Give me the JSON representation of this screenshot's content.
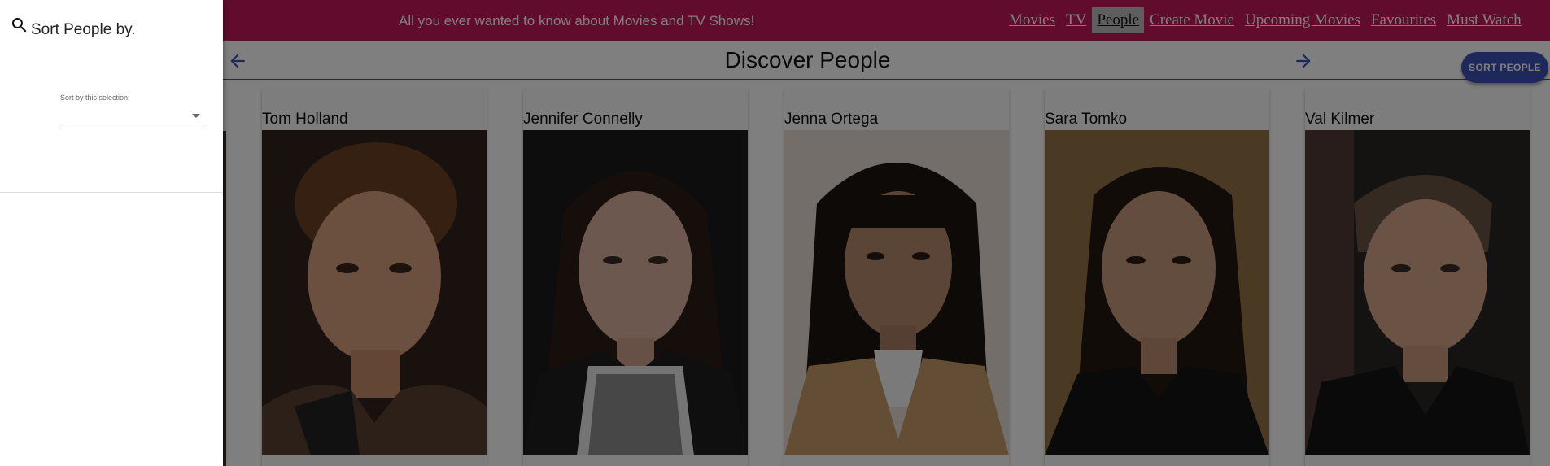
{
  "header": {
    "tagline": "All you ever wanted to know about Movies and TV Shows!",
    "nav": [
      {
        "label": "Movies",
        "active": false
      },
      {
        "label": "TV",
        "active": false
      },
      {
        "label": "People",
        "active": true
      },
      {
        "label": "Create Movie",
        "active": false
      },
      {
        "label": "Upcoming Movies",
        "active": false
      },
      {
        "label": "Favourites",
        "active": false
      },
      {
        "label": "Must Watch",
        "active": false
      }
    ],
    "color": "#c2185b"
  },
  "page": {
    "title": "Discover People",
    "sort_button_label": "SORT PEOPLE",
    "accent": "#3f51b5",
    "back_icon": "arrow-left-icon",
    "next_icon": "arrow-right-icon"
  },
  "people": [
    {
      "name": "Tom Holland"
    },
    {
      "name": "Jennifer Connelly"
    },
    {
      "name": "Jenna Ortega"
    },
    {
      "name": "Sara Tomko"
    },
    {
      "name": "Val Kilmer"
    }
  ],
  "drawer": {
    "icon": "search-icon",
    "title": "Sort People by.",
    "field_label": "Sort by this selection:",
    "field_value": ""
  }
}
